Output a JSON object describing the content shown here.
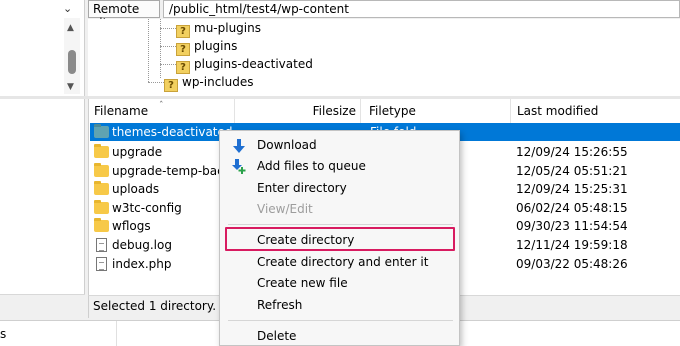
{
  "remote_site": {
    "label": "Remote site:",
    "path": "/public_html/test4/wp-content"
  },
  "tree": {
    "items": [
      {
        "name": "mu-plugins"
      },
      {
        "name": "plugins"
      },
      {
        "name": "plugins-deactivated"
      },
      {
        "name": "wp-includes"
      }
    ]
  },
  "file_list": {
    "headers": {
      "filename": "Filename",
      "filesize": "Filesize",
      "filetype": "Filetype",
      "last_modified": "Last modified"
    },
    "rows": [
      {
        "name": "themes-deactivated",
        "type": "File fold",
        "modified": "",
        "icon": "folder-icon",
        "selected": true
      },
      {
        "name": "upgrade",
        "type": "",
        "modified": "12/09/24 15:26:55",
        "icon": "folder-icon"
      },
      {
        "name": "upgrade-temp-backu",
        "type": "",
        "modified": "12/05/24 05:51:21",
        "icon": "folder-icon"
      },
      {
        "name": "uploads",
        "type": "",
        "modified": "12/09/24 15:25:31",
        "icon": "folder-icon"
      },
      {
        "name": "w3tc-config",
        "type": "",
        "modified": "06/02/24 05:48:15",
        "icon": "folder-icon"
      },
      {
        "name": "wflogs",
        "type": "",
        "modified": "09/30/23 11:54:54",
        "icon": "folder-icon"
      },
      {
        "name": "debug.log",
        "type": "",
        "modified": "12/11/24 19:59:18",
        "icon": "file-icon"
      },
      {
        "name": "index.php",
        "type": "",
        "modified": "09/03/22 05:48:26",
        "icon": "file-icon"
      }
    ]
  },
  "status": {
    "remote": "Selected 1 directory.",
    "queue_partial": "s"
  },
  "context_menu": {
    "items": [
      {
        "label": "Download",
        "icon": "download-icon",
        "enabled": true
      },
      {
        "label": "Add files to queue",
        "icon": "add-to-queue-icon",
        "enabled": true
      },
      {
        "label": "Enter directory",
        "enabled": true
      },
      {
        "label": "View/Edit",
        "enabled": false
      },
      {
        "label": "Create directory",
        "enabled": true,
        "highlighted": true
      },
      {
        "label": "Create directory and enter it",
        "enabled": true
      },
      {
        "label": "Create new file",
        "enabled": true
      },
      {
        "label": "Refresh",
        "enabled": true
      },
      {
        "label": "Delete",
        "enabled": true
      }
    ]
  },
  "colors": {
    "selection": "#0078d7",
    "highlight_box": "#d81b60",
    "folder": "#f7c948"
  }
}
